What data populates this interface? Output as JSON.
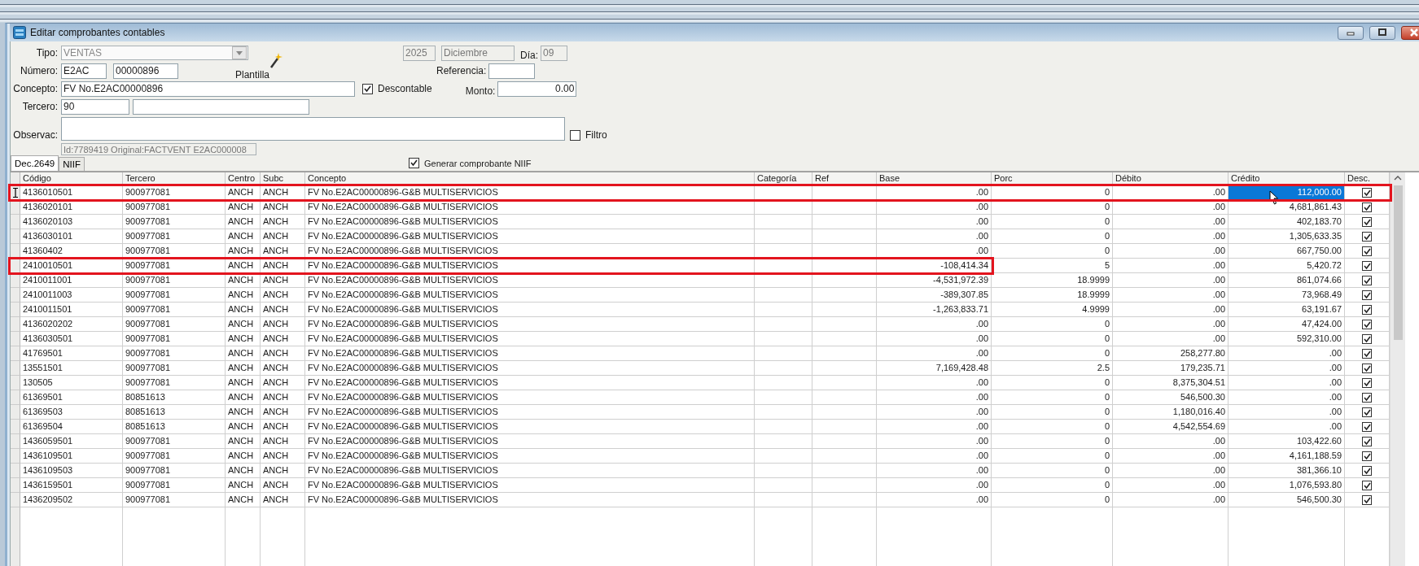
{
  "window": {
    "title": "Editar comprobantes contables"
  },
  "form": {
    "tipo": {
      "label": "Tipo:",
      "value": "VENTAS",
      "disabled": true
    },
    "year": {
      "value": "2025"
    },
    "month": {
      "value": "Diciembre"
    },
    "dia": {
      "label": "Día:",
      "value": "09"
    },
    "plantilla": {
      "label": "Plantilla"
    },
    "numero": {
      "label": "Número:",
      "prefix": "E2AC",
      "value": "00000896"
    },
    "referencia": {
      "label": "Referencia:"
    },
    "concepto": {
      "label": "Concepto:",
      "value": "FV No.E2AC00000896"
    },
    "descontable": {
      "label": "Descontable",
      "checked": true
    },
    "monto": {
      "label": "Monto:",
      "value": "0.00"
    },
    "tercero": {
      "label": "Tercero:",
      "value": "90"
    },
    "observac": {
      "label": "Observac:"
    },
    "filtro": {
      "label": "Filtro",
      "checked": false
    },
    "info": {
      "value": "Id:7789419 Original:FACTVENT E2AC000008"
    }
  },
  "tabs": [
    {
      "label": "Dec.2649",
      "selected": true
    },
    {
      "label": "NIIF",
      "selected": false
    }
  ],
  "generar_niif": {
    "label": "Generar comprobante NIIF",
    "checked": true
  },
  "table": {
    "columns": [
      {
        "label": "Código"
      },
      {
        "label": "Tercero"
      },
      {
        "label": "Centro"
      },
      {
        "label": "Subc"
      },
      {
        "label": "Concepto"
      },
      {
        "label": "Categoría"
      },
      {
        "label": "Ref"
      },
      {
        "label": "Base"
      },
      {
        "label": "Porc"
      },
      {
        "label": "Débito"
      },
      {
        "label": "Crédito"
      },
      {
        "label": "Desc."
      }
    ],
    "rows": [
      {
        "codigo": "4136010501",
        "tercero": "900977081",
        "centro": "ANCH",
        "subc": "ANCH",
        "concepto": "FV No.E2AC00000896-G&B MULTISERVICIOS",
        "base": ".00",
        "porc": "0",
        "debito": ".00",
        "credito": "112,000.00",
        "desc": true,
        "selected": true,
        "kind": "outlined"
      },
      {
        "codigo": "4136020101",
        "tercero": "900977081",
        "centro": "ANCH",
        "subc": "ANCH",
        "concepto": "FV No.E2AC00000896-G&B MULTISERVICIOS",
        "base": ".00",
        "porc": "0",
        "debito": ".00",
        "credito": "4,681,861.43",
        "desc": true,
        "selected": false
      },
      {
        "codigo": "4136020103",
        "tercero": "900977081",
        "centro": "ANCH",
        "subc": "ANCH",
        "concepto": "FV No.E2AC00000896-G&B MULTISERVICIOS",
        "base": ".00",
        "porc": "0",
        "debito": ".00",
        "credito": "402,183.70",
        "desc": true,
        "selected": false
      },
      {
        "codigo": "4136030101",
        "tercero": "900977081",
        "centro": "ANCH",
        "subc": "ANCH",
        "concepto": "FV No.E2AC00000896-G&B MULTISERVICIOS",
        "base": ".00",
        "porc": "0",
        "debito": ".00",
        "credito": "1,305,633.35",
        "desc": true,
        "selected": false
      },
      {
        "codigo": "41360402",
        "tercero": "900977081",
        "centro": "ANCH",
        "subc": "ANCH",
        "concepto": "FV No.E2AC00000896-G&B MULTISERVICIOS",
        "base": ".00",
        "porc": "0",
        "debito": ".00",
        "credito": "667,750.00",
        "desc": true,
        "selected": false
      },
      {
        "codigo": "2410010501",
        "tercero": "900977081",
        "centro": "ANCH",
        "subc": "ANCH",
        "concepto": "FV No.E2AC00000896-G&B MULTISERVICIOS",
        "base": "-108,414.34",
        "porc": "5",
        "debito": ".00",
        "credito": "5,420.72",
        "desc": true,
        "selected": false,
        "kind": "outlined_partial"
      },
      {
        "codigo": "2410011001",
        "tercero": "900977081",
        "centro": "ANCH",
        "subc": "ANCH",
        "concepto": "FV No.E2AC00000896-G&B MULTISERVICIOS",
        "base": "-4,531,972.39",
        "porc": "18.9999",
        "debito": ".00",
        "credito": "861,074.66",
        "desc": true,
        "selected": false
      },
      {
        "codigo": "2410011003",
        "tercero": "900977081",
        "centro": "ANCH",
        "subc": "ANCH",
        "concepto": "FV No.E2AC00000896-G&B MULTISERVICIOS",
        "base": "-389,307.85",
        "porc": "18.9999",
        "debito": ".00",
        "credito": "73,968.49",
        "desc": true,
        "selected": false
      },
      {
        "codigo": "2410011501",
        "tercero": "900977081",
        "centro": "ANCH",
        "subc": "ANCH",
        "concepto": "FV No.E2AC00000896-G&B MULTISERVICIOS",
        "base": "-1,263,833.71",
        "porc": "4.9999",
        "debito": ".00",
        "credito": "63,191.67",
        "desc": true,
        "selected": false
      },
      {
        "codigo": "4136020202",
        "tercero": "900977081",
        "centro": "ANCH",
        "subc": "ANCH",
        "concepto": "FV No.E2AC00000896-G&B MULTISERVICIOS",
        "base": ".00",
        "porc": "0",
        "debito": ".00",
        "credito": "47,424.00",
        "desc": true,
        "selected": false
      },
      {
        "codigo": "4136030501",
        "tercero": "900977081",
        "centro": "ANCH",
        "subc": "ANCH",
        "concepto": "FV No.E2AC00000896-G&B MULTISERVICIOS",
        "base": ".00",
        "porc": "0",
        "debito": ".00",
        "credito": "592,310.00",
        "desc": true,
        "selected": false
      },
      {
        "codigo": "41769501",
        "tercero": "900977081",
        "centro": "ANCH",
        "subc": "ANCH",
        "concepto": "FV No.E2AC00000896-G&B MULTISERVICIOS",
        "base": ".00",
        "porc": "0",
        "debito": "258,277.80",
        "credito": ".00",
        "desc": true,
        "selected": false
      },
      {
        "codigo": "13551501",
        "tercero": "900977081",
        "centro": "ANCH",
        "subc": "ANCH",
        "concepto": "FV No.E2AC00000896-G&B MULTISERVICIOS",
        "base": "7,169,428.48",
        "porc": "2.5",
        "debito": "179,235.71",
        "credito": ".00",
        "desc": true,
        "selected": false
      },
      {
        "codigo": "130505",
        "tercero": "900977081",
        "centro": "ANCH",
        "subc": "ANCH",
        "concepto": "FV No.E2AC00000896-G&B MULTISERVICIOS",
        "base": ".00",
        "porc": "0",
        "debito": "8,375,304.51",
        "credito": ".00",
        "desc": true,
        "selected": false
      },
      {
        "codigo": "61369501",
        "tercero": "80851613",
        "centro": "ANCH",
        "subc": "ANCH",
        "concepto": "FV No.E2AC00000896-G&B MULTISERVICIOS",
        "base": ".00",
        "porc": "0",
        "debito": "546,500.30",
        "credito": ".00",
        "desc": true,
        "selected": false
      },
      {
        "codigo": "61369503",
        "tercero": "80851613",
        "centro": "ANCH",
        "subc": "ANCH",
        "concepto": "FV No.E2AC00000896-G&B MULTISERVICIOS",
        "base": ".00",
        "porc": "0",
        "debito": "1,180,016.40",
        "credito": ".00",
        "desc": true,
        "selected": false
      },
      {
        "codigo": "61369504",
        "tercero": "80851613",
        "centro": "ANCH",
        "subc": "ANCH",
        "concepto": "FV No.E2AC00000896-G&B MULTISERVICIOS",
        "base": ".00",
        "porc": "0",
        "debito": "4,542,554.69",
        "credito": ".00",
        "desc": true,
        "selected": false
      },
      {
        "codigo": "1436059501",
        "tercero": "900977081",
        "centro": "ANCH",
        "subc": "ANCH",
        "concepto": "FV No.E2AC00000896-G&B MULTISERVICIOS",
        "base": ".00",
        "porc": "0",
        "debito": ".00",
        "credito": "103,422.60",
        "desc": true,
        "selected": false
      },
      {
        "codigo": "1436109501",
        "tercero": "900977081",
        "centro": "ANCH",
        "subc": "ANCH",
        "concepto": "FV No.E2AC00000896-G&B MULTISERVICIOS",
        "base": ".00",
        "porc": "0",
        "debito": ".00",
        "credito": "4,161,188.59",
        "desc": true,
        "selected": false
      },
      {
        "codigo": "1436109503",
        "tercero": "900977081",
        "centro": "ANCH",
        "subc": "ANCH",
        "concepto": "FV No.E2AC00000896-G&B MULTISERVICIOS",
        "base": ".00",
        "porc": "0",
        "debito": ".00",
        "credito": "381,366.10",
        "desc": true,
        "selected": false
      },
      {
        "codigo": "1436159501",
        "tercero": "900977081",
        "centro": "ANCH",
        "subc": "ANCH",
        "concepto": "FV No.E2AC00000896-G&B MULTISERVICIOS",
        "base": ".00",
        "porc": "0",
        "debito": ".00",
        "credito": "1,076,593.80",
        "desc": true,
        "selected": false
      },
      {
        "codigo": "1436209502",
        "tercero": "900977081",
        "centro": "ANCH",
        "subc": "ANCH",
        "concepto": "FV No.E2AC00000896-G&B MULTISERVICIOS",
        "base": ".00",
        "porc": "0",
        "debito": ".00",
        "credito": "546,500.30",
        "desc": true,
        "selected": false
      }
    ]
  }
}
